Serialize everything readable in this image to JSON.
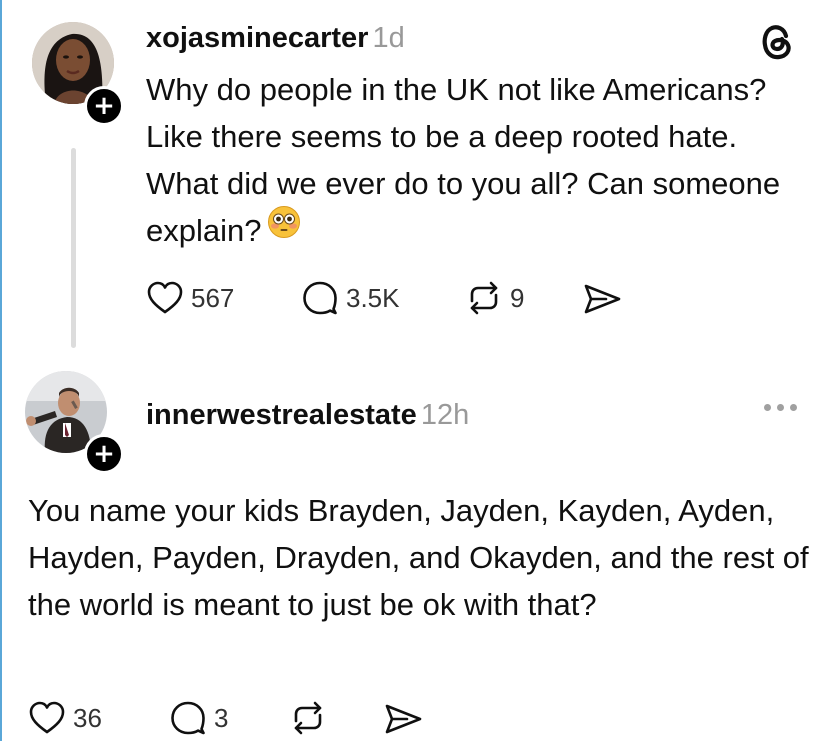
{
  "post1": {
    "username": "xojasminecarter",
    "timestamp": "1d",
    "text": "Why do people in the UK not like Americans? Like there seems to be a deep rooted hate. What did we ever do to you all? Can someone explain?",
    "emoji": "flushed-face",
    "likes": "567",
    "replies": "3.5K",
    "reposts": "9"
  },
  "post2": {
    "username": "innerwestrealestate",
    "timestamp": "12h",
    "text": "You name your kids Brayden, Jayden, Kayden, Ayden, Hayden, Payden, Drayden, and Okayden, and the rest of the world is meant to just be ok with that?",
    "likes": "36",
    "replies": "3"
  },
  "icons": {
    "logo": "threads-logo-icon",
    "like": "heart-icon",
    "reply": "comment-bubble-icon",
    "repost": "repost-arrows-icon",
    "share": "send-icon",
    "more": "more-dots-icon",
    "follow": "plus-icon"
  },
  "follow_badge": "+",
  "colors": {
    "text": "#101010",
    "secondary": "#999999",
    "thread_line": "#dcdcdc",
    "badge": "#000000"
  }
}
